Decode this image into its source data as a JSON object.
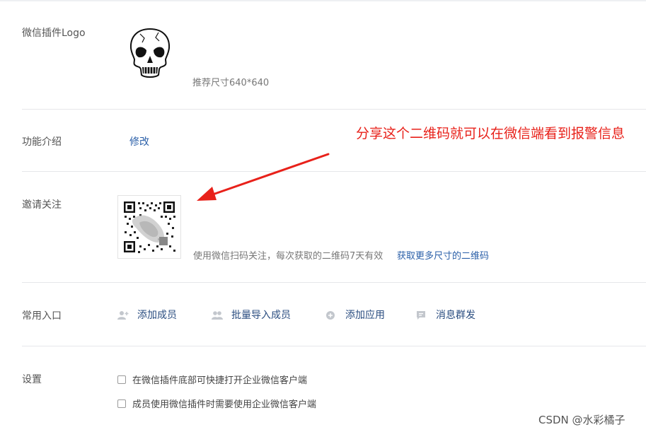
{
  "rows": {
    "logo": {
      "label": "微信插件Logo",
      "hint": "推荐尺寸640*640"
    },
    "intro": {
      "label": "功能介绍",
      "edit_link": "修改"
    },
    "invite": {
      "label": "邀请关注",
      "hint": "使用微信扫码关注，每次获取的二维码7天有效",
      "more_link": "获取更多尺寸的二维码"
    },
    "entries": {
      "label": "常用入口",
      "items": [
        {
          "label": "添加成员",
          "icon": "add-user-icon"
        },
        {
          "label": "批量导入成员",
          "icon": "users-icon"
        },
        {
          "label": "添加应用",
          "icon": "add-app-icon"
        },
        {
          "label": "消息群发",
          "icon": "message-icon"
        }
      ]
    },
    "settings": {
      "label": "设置",
      "options": [
        {
          "label": "在微信插件底部可快捷打开企业微信客户端",
          "checked": false
        },
        {
          "label": "成员使用微信插件时需要使用企业微信客户端",
          "checked": false
        }
      ]
    }
  },
  "annotation": {
    "text": "分享这个二维码就可以在微信端看到报警信息",
    "color": "#e8211a"
  },
  "watermark": "CSDN @水彩橘子",
  "colors": {
    "link": "#2a5fa8",
    "divider": "#e6e7ea",
    "annotation": "#e8211a"
  }
}
